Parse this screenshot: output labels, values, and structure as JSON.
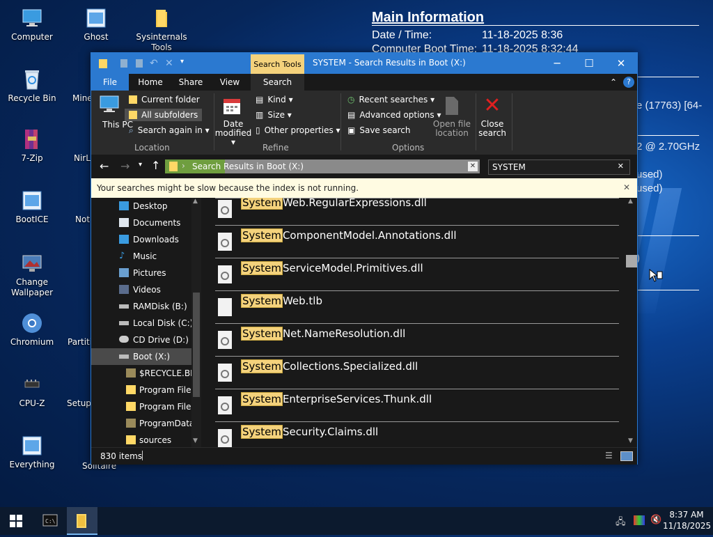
{
  "desktop_icons": [
    {
      "label": "Computer",
      "icon": "computer-icon"
    },
    {
      "label": "Ghost",
      "icon": "ghost-app-icon"
    },
    {
      "label": "Sysinternals Tools",
      "icon": "folder-icon"
    },
    {
      "label": "Recycle Bin",
      "icon": "recycle-bin-icon"
    },
    {
      "label": "Mine",
      "icon": "minesweeper-icon"
    },
    {
      "label": "7-Zip",
      "icon": "7zip-icon"
    },
    {
      "label": "NirL",
      "icon": "nirlauncher-icon"
    },
    {
      "label": "BootICE",
      "icon": "bootice-icon"
    },
    {
      "label": "Not",
      "icon": "notepad-icon"
    },
    {
      "label": "Change Wallpaper",
      "icon": "wallpaper-icon"
    },
    {
      "label": "Chromium",
      "icon": "chromium-icon"
    },
    {
      "label": "Partiti",
      "icon": "partition-icon"
    },
    {
      "label": "CPU-Z",
      "icon": "cpuz-icon"
    },
    {
      "label": "Setup",
      "icon": "setup-icon"
    },
    {
      "label": "Everything",
      "icon": "everything-icon"
    },
    {
      "label": "Solitaire",
      "icon": "solitaire-icon"
    }
  ],
  "info_panel": {
    "title": "Main Information",
    "date_label": "Date / Time:",
    "date_value": "11-18-2025 8:36",
    "boot_label": "Computer Boot Time:",
    "boot_value": "11-18-2025 8:32:44",
    "frag_os": "e (17763) [64-",
    "frag_cpu": "2 @ 2.70GHz",
    "frag_used1": "used)",
    "frag_used2": "used)",
    "frag_paren": ")"
  },
  "window": {
    "title": "SYSTEM - Search Results in Boot (X:)",
    "context_tab": "Search Tools",
    "tabs": [
      "File",
      "Home",
      "Share",
      "View",
      "Search"
    ],
    "ribbon": {
      "this_pc": "This PC",
      "current_folder": "Current folder",
      "all_subfolders": "All subfolders",
      "search_again_in": "Search again in",
      "location_group": "Location",
      "date_modified": "Date modified",
      "kind": "Kind",
      "size": "Size",
      "other_properties": "Other properties",
      "refine_group": "Refine",
      "recent_searches": "Recent searches",
      "advanced_options": "Advanced options",
      "save_search": "Save search",
      "open_file_location": "Open file location",
      "options_group": "Options",
      "close_search": "Close search"
    },
    "address": {
      "path": "Search Results in Boot (X:)",
      "search_value": "SYSTEM"
    },
    "infobar_text": "Your searches might be slow because the index is not running.",
    "nav_items": [
      {
        "label": "Desktop",
        "icon": "desktop-folder-icon"
      },
      {
        "label": "Documents",
        "icon": "documents-folder-icon"
      },
      {
        "label": "Downloads",
        "icon": "downloads-folder-icon"
      },
      {
        "label": "Music",
        "icon": "music-folder-icon"
      },
      {
        "label": "Pictures",
        "icon": "pictures-folder-icon"
      },
      {
        "label": "Videos",
        "icon": "videos-folder-icon"
      },
      {
        "label": "RAMDisk (B:)",
        "icon": "drive-icon"
      },
      {
        "label": "Local Disk (C:)",
        "icon": "drive-icon"
      },
      {
        "label": "CD Drive (D:) v",
        "icon": "cd-drive-icon"
      },
      {
        "label": "Boot (X:)",
        "icon": "drive-icon"
      },
      {
        "label": "$RECYCLE.BIN",
        "icon": "folder-icon"
      },
      {
        "label": "Program Files",
        "icon": "folder-icon"
      },
      {
        "label": "Program Files",
        "icon": "folder-icon"
      },
      {
        "label": "ProgramData",
        "icon": "folder-icon"
      },
      {
        "label": "sources",
        "icon": "folder-icon"
      }
    ],
    "results": [
      {
        "match": "System",
        "rest": "Web.RegularExpressions.dll",
        "icon": "dll-file-icon"
      },
      {
        "match": "System",
        "rest": "ComponentModel.Annotations.dll",
        "icon": "dll-file-icon"
      },
      {
        "match": "System",
        "rest": "ServiceModel.Primitives.dll",
        "icon": "dll-file-icon"
      },
      {
        "match": "System",
        "rest": "Web.tlb",
        "icon": "blank-file-icon"
      },
      {
        "match": "System",
        "rest": "Net.NameResolution.dll",
        "icon": "dll-file-icon"
      },
      {
        "match": "System",
        "rest": "Collections.Specialized.dll",
        "icon": "dll-file-icon"
      },
      {
        "match": "System",
        "rest": "EnterpriseServices.Thunk.dll",
        "icon": "dll-file-icon"
      },
      {
        "match": "System",
        "rest": "Security.Claims.dll",
        "icon": "dll-file-icon"
      }
    ],
    "status_count": "830 items"
  },
  "taskbar": {
    "time": "8:37 AM",
    "date": "11/18/2025"
  },
  "colors": {
    "accent": "#2b79d0",
    "search_highlight": "#f4d27c",
    "close_search_red": "#e02020"
  }
}
